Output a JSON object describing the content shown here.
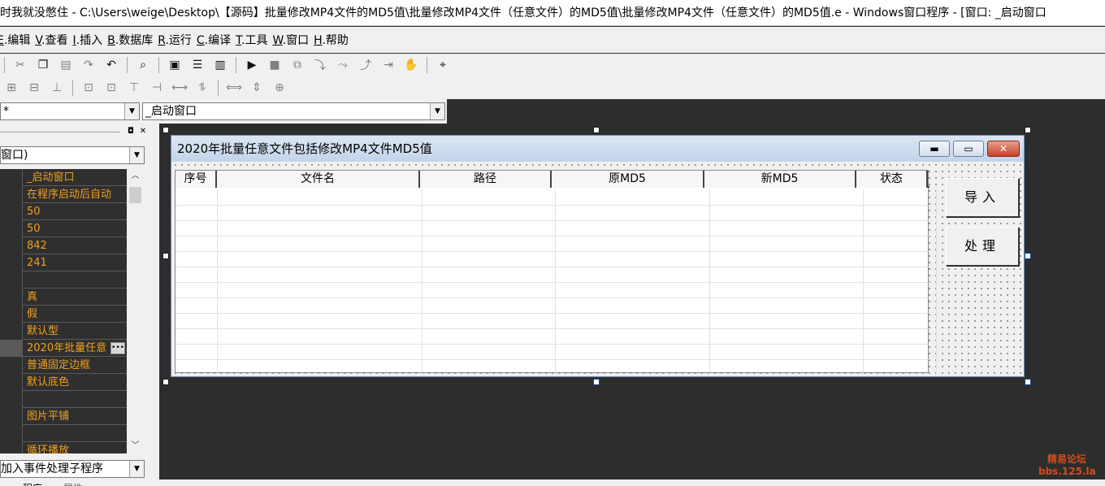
{
  "window": {
    "title": "时我就没憋住 - C:\\Users\\weige\\Desktop\\【源码】批量修改MP4文件的MD5值\\批量修改MP4文件（任意文件）的MD5值\\批量修改MP4文件（任意文件）的MD5值.e - Windows窗口程序 - [窗口: _启动窗口"
  },
  "menu": [
    {
      "key": "E",
      "label": ".编辑"
    },
    {
      "key": "V",
      "label": ".查看"
    },
    {
      "key": "I",
      "label": ".插入"
    },
    {
      "key": "B",
      "label": ".数据库"
    },
    {
      "key": "R",
      "label": ".运行"
    },
    {
      "key": "C",
      "label": ".编译"
    },
    {
      "key": "T",
      "label": ".工具"
    },
    {
      "key": "W",
      "label": ".窗口"
    },
    {
      "key": "H",
      "label": ".帮助"
    }
  ],
  "selectors": {
    "left_value": "*",
    "right_value": "_启动窗口"
  },
  "left_panel": {
    "object_combo": "窗口)",
    "properties": [
      {
        "value": "_启动窗口"
      },
      {
        "value": "在程序启动后自动"
      },
      {
        "value": "50"
      },
      {
        "value": "50"
      },
      {
        "value": "842"
      },
      {
        "value": "241"
      },
      {
        "value": ""
      },
      {
        "value": "真"
      },
      {
        "value": "假"
      },
      {
        "value": "默认型"
      },
      {
        "value": "2020年批量任意"
      },
      {
        "value": "普通固定边框"
      },
      {
        "value": "默认底色"
      },
      {
        "value": ""
      },
      {
        "value": "图片平铺"
      },
      {
        "value": ""
      },
      {
        "value": "循环播放"
      }
    ],
    "event_combo": "加入事件处理子程序",
    "tabs": [
      "程序",
      "属性"
    ]
  },
  "form": {
    "title": "2020年批量任意文件包括修改MP4文件MD5值",
    "columns": [
      "序号",
      "文件名",
      "路径",
      "原MD5",
      "新MD5",
      "状态"
    ],
    "buttons": {
      "import": "导入",
      "process": "处理"
    },
    "window_buttons": {
      "minimize": "▬",
      "maximize": "▭",
      "close": "✕"
    }
  },
  "watermark": {
    "line1": "精易论坛",
    "line2": "bbs.125.la"
  },
  "colors": {
    "property_value": "#f0a020",
    "workspace": "#2d2d2d",
    "form_title": "#c9d8ec"
  }
}
